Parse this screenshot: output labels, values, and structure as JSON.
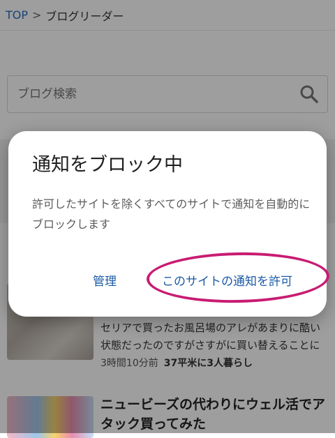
{
  "breadcrumb": {
    "top": "TOP",
    "separator": ">",
    "current": "ブログリーダー"
  },
  "search": {
    "placeholder": "ブログ検索"
  },
  "articles": [
    {
      "snippet": "セリアで買ったお風呂場のアレがあまりに酷い状態だったのですがさすがに買い替えることにし…",
      "time": "3時間10分前",
      "blog": "37平米に3人暮らし"
    },
    {
      "title": "ニュービーズの代わりにウェル活でアタック買ってみた"
    }
  ],
  "dialog": {
    "title": "通知をブロック中",
    "message": "許可したサイトを除くすべてのサイトで通知を自動的にブロックします",
    "manage_label": "管理",
    "allow_label": "このサイトの通知を許可"
  },
  "colors": {
    "accent": "#1a5aa6",
    "highlight": "#c81c72",
    "link": "#2a6fbd"
  }
}
